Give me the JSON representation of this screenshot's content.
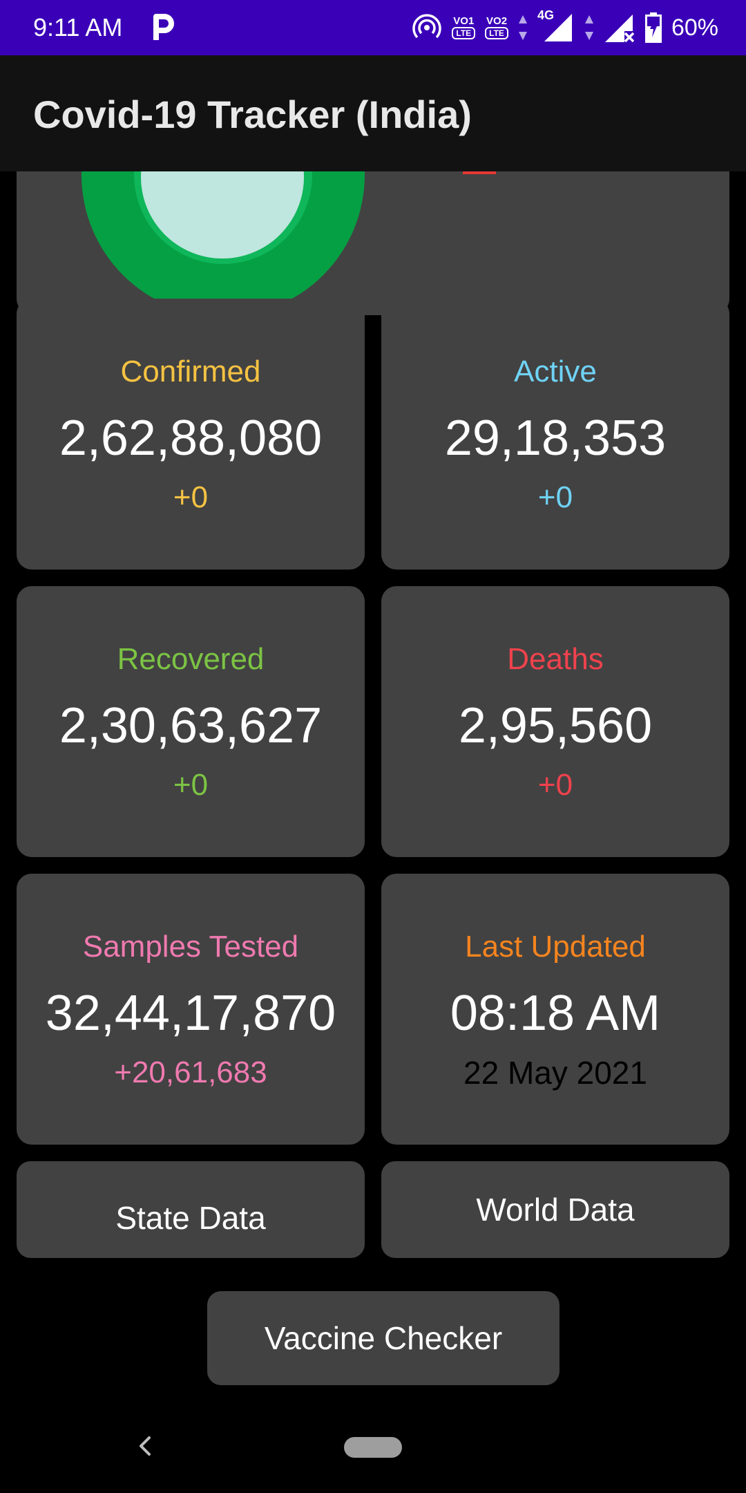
{
  "status_bar": {
    "time": "9:11 AM",
    "app_icon": "p-icon",
    "sim1_label": "VO",
    "sim1_num": "1",
    "sim1_sub": "LTE",
    "sim2_label": "VO",
    "sim2_num": "2",
    "sim2_sub": "LTE",
    "network_type": "4G",
    "battery_percent": "60%"
  },
  "app_bar": {
    "title": "Covid-19 Tracker (India)"
  },
  "cards": {
    "confirmed": {
      "label": "Confirmed",
      "value": "2,62,88,080",
      "delta": "+0",
      "color": "#f5c242"
    },
    "active": {
      "label": "Active",
      "value": "29,18,353",
      "delta": "+0",
      "color": "#6fd3f5"
    },
    "recovered": {
      "label": "Recovered",
      "value": "2,30,63,627",
      "delta": "+0",
      "color": "#7cc444"
    },
    "deaths": {
      "label": "Deaths",
      "value": "2,95,560",
      "delta": "+0",
      "color": "#f0424d"
    },
    "samples": {
      "label": "Samples Tested",
      "value": "32,44,17,870",
      "delta": "+20,61,683",
      "color": "#f07ab0"
    },
    "updated": {
      "label": "Last Updated",
      "time": "08:18 AM",
      "date": "22 May 2021",
      "color": "#f5841f"
    }
  },
  "buttons": {
    "state_data": "State Data",
    "world_data": "World Data",
    "vaccine_checker": "Vaccine Checker"
  },
  "chart_colors": {
    "recovered_ring": "#05a043",
    "inner": "#bfe6df",
    "deaths_mark": "#e53935"
  }
}
